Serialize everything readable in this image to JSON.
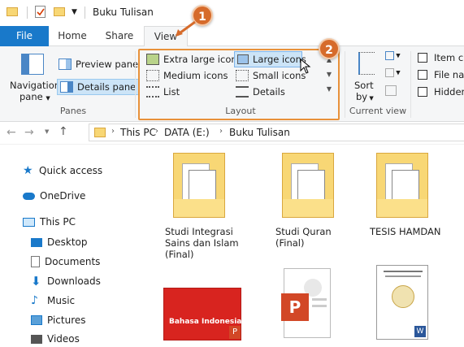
{
  "window": {
    "folder_name": "Buku Tulisan"
  },
  "tabs": [
    {
      "label": "File"
    },
    {
      "label": "Home"
    },
    {
      "label": "Share"
    },
    {
      "label": "View"
    }
  ],
  "ribbon": {
    "panes": {
      "navigation_pane_label_1": "Navigation",
      "navigation_pane_label_2": "pane",
      "preview_pane": "Preview pane",
      "details_pane": "Details pane",
      "group_label": "Panes"
    },
    "layout": {
      "extra_large_icons": "Extra large icons",
      "large_icons": "Large icons",
      "medium_icons": "Medium icons",
      "small_icons": "Small icons",
      "list": "List",
      "details": "Details",
      "group_label": "Layout",
      "selected": "Large icons"
    },
    "current_view": {
      "sort_label_1": "Sort",
      "sort_label_2": "by",
      "group_label": "Current view"
    },
    "show_hide": {
      "item_check_boxes": "Item ch",
      "file_name_extensions": "File nan",
      "hidden_items": "Hidden"
    }
  },
  "address": {
    "crumbs": [
      "This PC",
      "DATA (E:)",
      "Buku Tulisan"
    ]
  },
  "sidebar": {
    "items": [
      {
        "label": "Quick access"
      },
      {
        "label": "OneDrive"
      },
      {
        "label": "This PC"
      },
      {
        "label": "Desktop"
      },
      {
        "label": "Documents"
      },
      {
        "label": "Downloads"
      },
      {
        "label": "Music"
      },
      {
        "label": "Pictures"
      },
      {
        "label": "Videos"
      }
    ]
  },
  "content": {
    "folders": [
      {
        "name": "Studi Integrasi Sains dan Islam (Final)"
      },
      {
        "name": "Studi Quran (Final)"
      },
      {
        "name": "TESIS HAMDAN"
      }
    ],
    "file_thumb_text": "Bahasa Indonesia"
  },
  "annotations": {
    "step1": "1",
    "step2": "2"
  },
  "colors": {
    "accent": "#1979ca",
    "highlight_box": "#e8913a",
    "badge": "#d66b2b",
    "folder": "#f8d775"
  }
}
